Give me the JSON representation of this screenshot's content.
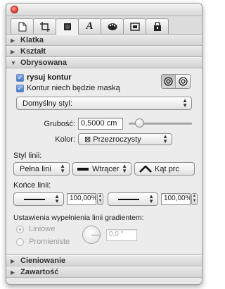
{
  "window": {
    "tabs": [
      {
        "icon": "document-icon"
      },
      {
        "icon": "frame-crop-icon"
      },
      {
        "icon": "stroke-square-icon",
        "active": true
      },
      {
        "icon": "text-a-icon",
        "glyph": "A"
      },
      {
        "icon": "palette-icon"
      },
      {
        "icon": "media-frame-icon"
      },
      {
        "icon": "lock-document-icon"
      }
    ]
  },
  "sections": {
    "klatka": "Klatka",
    "ksztalt": "Kształt",
    "obrysowana": "Obrysowana",
    "cieniowanie": "Cieniowanie",
    "zawartosc": "Zawartość"
  },
  "obrys": {
    "rysuj_kontur": "rysuj kontur",
    "kontur_maska": "Kontur niech będzie maską",
    "style_popup": "Domyślny styl:",
    "grubosc_label": "Grubość:",
    "grubosc_value": "0,5000 cm",
    "kolor_label": "Kolor:",
    "kolor_value": "⊠ Przezroczysty",
    "styl_linii_label": "Styl linii:",
    "styl_linii_1": "Pełna lini",
    "styl_linii_2": "Wtrącer",
    "styl_linii_3": "Kąt prc",
    "konce_linii_label": "Końce linii:",
    "konce_left_value": "100,00%",
    "konce_right_value": "100,00%",
    "gradient_label": "Ustawienia wypełnienia linii gradientem:",
    "liniowe": "Liniowe",
    "promieniste": "Promieniste",
    "angle_value": "0,0 °",
    "slider_position": 0.12
  },
  "colors": {
    "accent_checkbox": "#3f78d2",
    "close_button": "#d8382b"
  }
}
